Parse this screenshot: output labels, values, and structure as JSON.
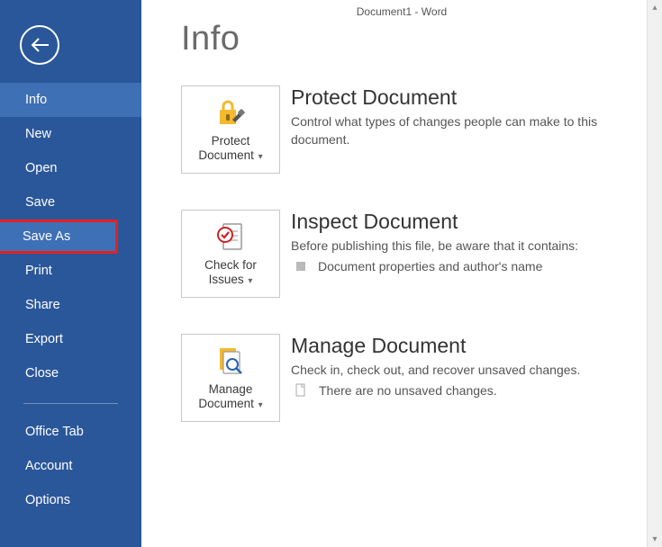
{
  "header": {
    "title": "Document1 - Word"
  },
  "sidebar": {
    "items": [
      "Info",
      "New",
      "Open",
      "Save",
      "Save As",
      "Print",
      "Share",
      "Export",
      "Close"
    ],
    "secondary": [
      "Office Tab",
      "Account",
      "Options"
    ],
    "active_index": 0,
    "highlighted_index": 4
  },
  "main": {
    "title": "Info",
    "sections": [
      {
        "tile_line1": "Protect",
        "tile_line2": "Document",
        "heading": "Protect Document",
        "desc": "Control what types of changes people can make to this document."
      },
      {
        "tile_line1": "Check for",
        "tile_line2": "Issues",
        "heading": "Inspect Document",
        "desc": "Before publishing this file, be aware that it contains:",
        "bullet": "Document properties and author's name"
      },
      {
        "tile_line1": "Manage",
        "tile_line2": "Document",
        "heading": "Manage Document",
        "desc": "Check in, check out, and recover unsaved changes.",
        "bullet": "There are no unsaved changes."
      }
    ]
  }
}
